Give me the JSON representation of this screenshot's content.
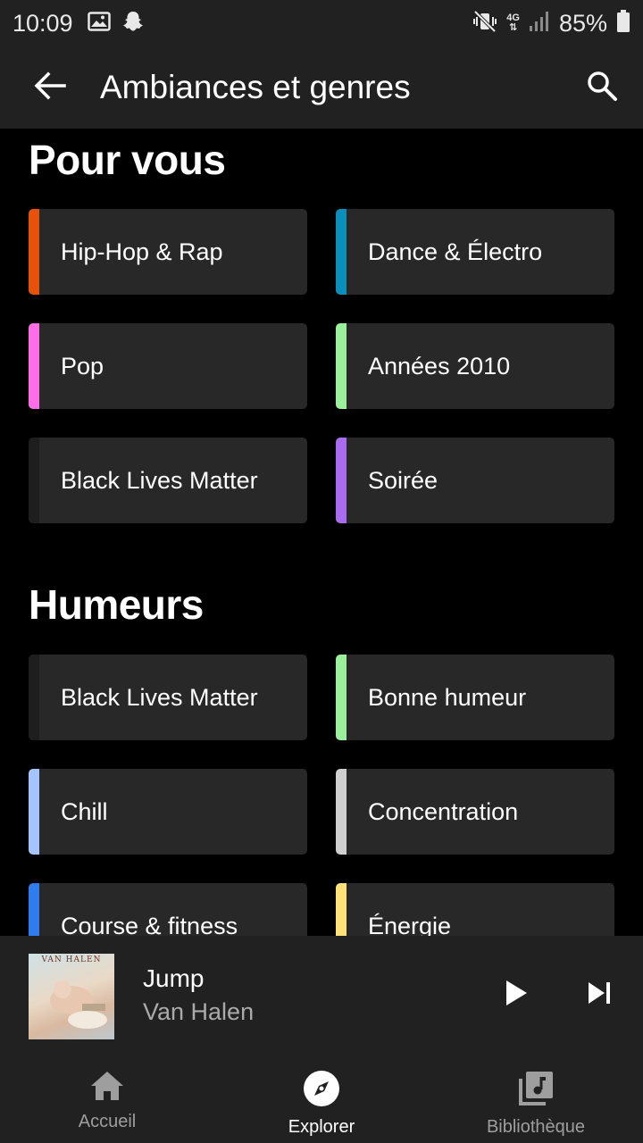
{
  "status_bar": {
    "time": "10:09",
    "battery": "85%",
    "network": "4G",
    "left_icons": [
      "gallery-icon",
      "snapchat-icon"
    ],
    "right_icons": [
      "mute-vibrate-icon",
      "data-arrows-icon",
      "signal-icon",
      "battery-icon"
    ]
  },
  "app_bar": {
    "title": "Ambiances et genres",
    "back_icon": "arrow-left-icon",
    "search_icon": "search-icon"
  },
  "sections": [
    {
      "title": "Pour vous",
      "tiles": [
        {
          "label": "Hip-Hop & Rap",
          "color": "#e8510a"
        },
        {
          "label": "Dance & Électro",
          "color": "#0a8fbd"
        },
        {
          "label": "Pop",
          "color": "#ff6ee8"
        },
        {
          "label": "Années 2010",
          "color": "#9bf09b"
        },
        {
          "label": "Black Lives Matter",
          "color": "#1e1e1e"
        },
        {
          "label": "Soirée",
          "color": "#a96bf0"
        }
      ]
    },
    {
      "title": "Humeurs",
      "tiles": [
        {
          "label": "Black Lives Matter",
          "color": "#1e1e1e"
        },
        {
          "label": "Bonne humeur",
          "color": "#9bf09b"
        },
        {
          "label": "Chill",
          "color": "#a4c4ff"
        },
        {
          "label": "Concentration",
          "color": "#cfcfcf"
        },
        {
          "label": "Course & fitness",
          "color": "#2f7bf0"
        },
        {
          "label": "Énergie",
          "color": "#ffe17a"
        }
      ]
    }
  ],
  "player": {
    "album_art_text": "VAN HALEN",
    "song": "Jump",
    "artist": "Van Halen",
    "play_icon": "play-icon",
    "next_icon": "skip-next-icon"
  },
  "bottom_nav": [
    {
      "label": "Accueil",
      "icon": "home-icon",
      "active": false
    },
    {
      "label": "Explorer",
      "icon": "compass-icon",
      "active": true
    },
    {
      "label": "Bibliothèque",
      "icon": "library-icon",
      "active": false
    }
  ],
  "colors": {
    "background": "#000000",
    "surface": "#212121",
    "tile": "#282828"
  }
}
